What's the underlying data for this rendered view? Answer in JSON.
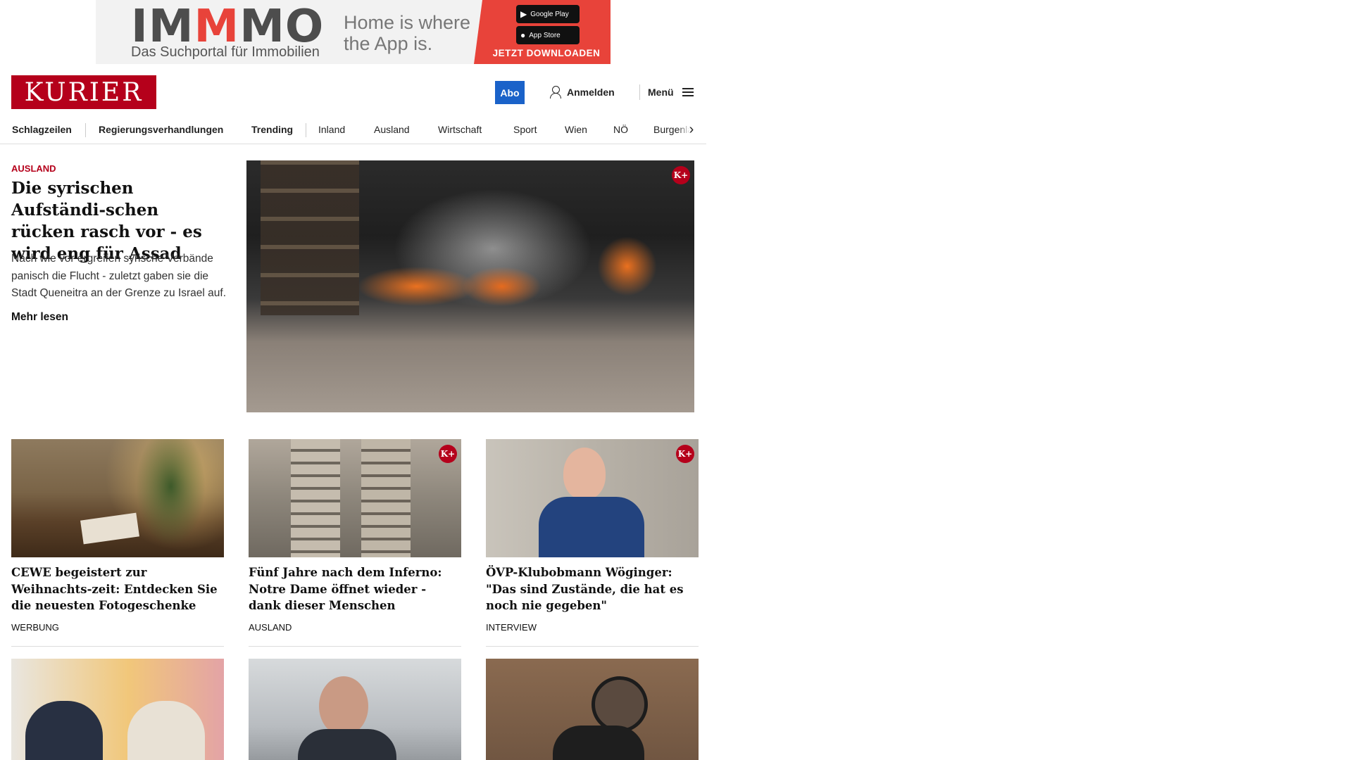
{
  "ad": {
    "logo_a": "IM",
    "logo_b": "M",
    "logo_c": "MO",
    "subtitle": "Das Suchportal für Immobilien",
    "tagline": "Home is where the App is.",
    "google_play": "Google Play",
    "app_store": "App Store",
    "cta": "JETZT DOWNLOADEN"
  },
  "header": {
    "logo": "KURIER",
    "abo": "Abo",
    "login": "Anmelden",
    "menu": "Menü"
  },
  "nav": {
    "items": [
      "Schlagzeilen",
      "Regierungsverhandlungen",
      "Trending",
      "Inland",
      "Ausland",
      "Wirtschaft",
      "Sport",
      "Wien",
      "NÖ",
      "Burgenland"
    ]
  },
  "hero": {
    "category": "AUSLAND",
    "title": "Die syrischen Aufständi-schen rücken rasch vor - es wird eng für Assad",
    "teaser": "Nach wie vor ergreifen syrische Verbände panisch die Flucht - zuletzt gaben sie die Stadt Queneitra an der Grenze zu Israel auf.",
    "more": "Mehr lesen",
    "badge": "K+"
  },
  "cards": [
    {
      "title": "CEWE begeistert zur Weihnachts-zeit: Entdecken Sie die neuesten Fotogeschenke",
      "category": "WERBUNG"
    },
    {
      "title": "Fünf Jahre nach dem Inferno: Notre Dame öffnet wieder - dank dieser Menschen",
      "category": "AUSLAND",
      "badge": "K+"
    },
    {
      "title": "ÖVP-Klubobmann Wöginger: \"Das sind Zustände, die hat es noch nie gegeben\"",
      "category": "INTERVIEW",
      "badge": "K+"
    }
  ]
}
